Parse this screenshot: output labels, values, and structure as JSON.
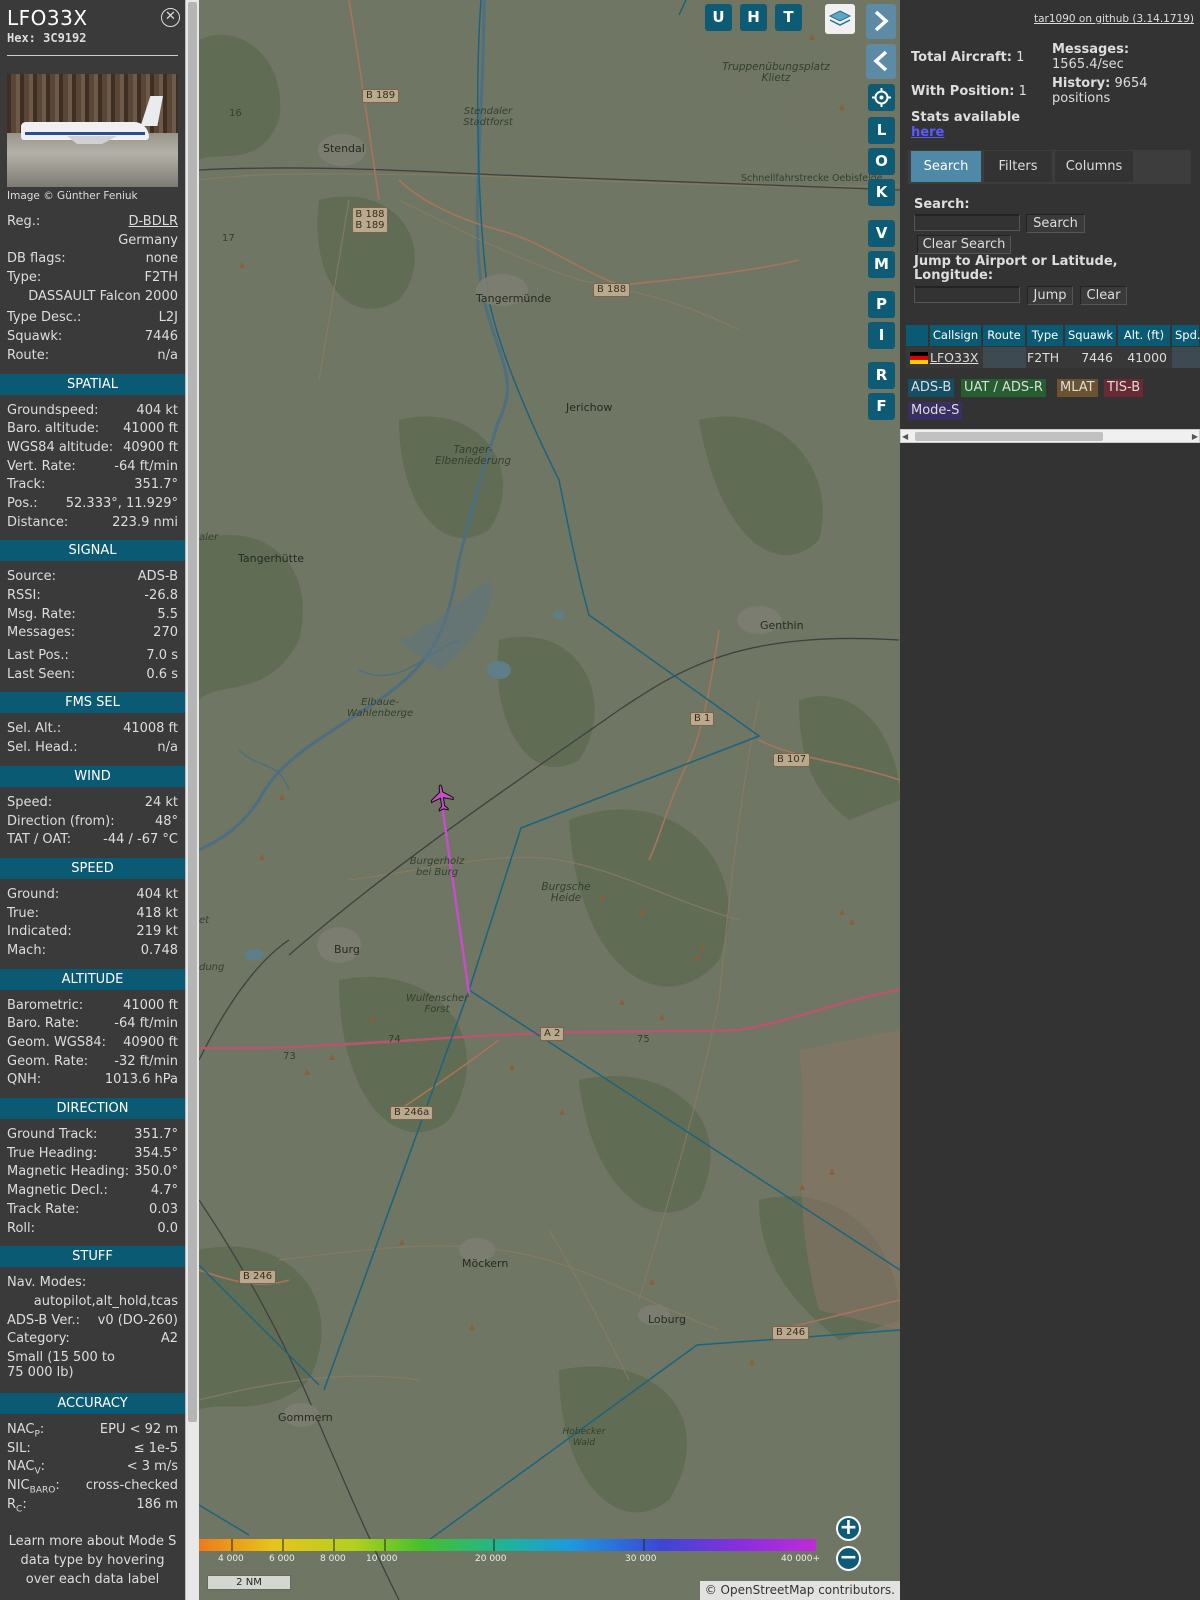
{
  "aircraft": {
    "callsign": "LFO33X",
    "hex": "Hex: 3C9192",
    "image_credit": "Image © Günther Feniuk",
    "reg_label": "Reg.:",
    "reg": "D-BDLR",
    "country": "Germany",
    "dbflags_label": "DB flags:",
    "dbflags": "none",
    "type_label": "Type:",
    "type": "F2TH",
    "type_full": "DASSAULT Falcon 2000",
    "typedesc_label": "Type Desc.:",
    "typedesc": "L2J",
    "squawk_label": "Squawk:",
    "squawk": "7446",
    "route_label": "Route:",
    "route": "n/a"
  },
  "sections": {
    "spatial": "SPATIAL",
    "signal": "SIGNAL",
    "fms": "FMS SEL",
    "wind": "WIND",
    "speed": "SPEED",
    "altitude": "ALTITUDE",
    "direction": "DIRECTION",
    "stuff": "STUFF",
    "accuracy": "ACCURACY"
  },
  "spatial": [
    {
      "k": "Groundspeed:",
      "v": "404 kt"
    },
    {
      "k": "Baro. altitude:",
      "v": "41000 ft"
    },
    {
      "k": "WGS84 altitude:",
      "v": "40900 ft"
    },
    {
      "k": "Vert. Rate:",
      "v": "-64 ft/min"
    },
    {
      "k": "Track:",
      "v": "351.7°"
    },
    {
      "k": "Pos.:",
      "v": "52.333°, 11.929°"
    },
    {
      "k": "Distance:",
      "v": "223.9 nmi"
    }
  ],
  "signal": [
    {
      "k": "Source:",
      "v": "ADS-B"
    },
    {
      "k": "RSSI:",
      "v": "-26.8"
    },
    {
      "k": "Msg. Rate:",
      "v": "5.5"
    },
    {
      "k": "Messages:",
      "v": "270"
    },
    {
      "k": "Last Pos.:",
      "v": "7.0 s"
    },
    {
      "k": "Last Seen:",
      "v": "0.6 s"
    }
  ],
  "fms": [
    {
      "k": "Sel. Alt.:",
      "v": "41008 ft"
    },
    {
      "k": "Sel. Head.:",
      "v": "n/a"
    }
  ],
  "wind": [
    {
      "k": "Speed:",
      "v": "24 kt"
    },
    {
      "k": "Direction (from):",
      "v": "48°"
    },
    {
      "k": "TAT / OAT:",
      "v": "-44 / -67 °C"
    }
  ],
  "speed": [
    {
      "k": "Ground:",
      "v": "404 kt"
    },
    {
      "k": "True:",
      "v": "418 kt"
    },
    {
      "k": "Indicated:",
      "v": "219 kt"
    },
    {
      "k": "Mach:",
      "v": "0.748"
    }
  ],
  "altitude": [
    {
      "k": "Barometric:",
      "v": "41000 ft"
    },
    {
      "k": "Baro. Rate:",
      "v": "-64 ft/min"
    },
    {
      "k": "Geom. WGS84:",
      "v": "40900 ft"
    },
    {
      "k": "Geom. Rate:",
      "v": "-32 ft/min"
    },
    {
      "k": "QNH:",
      "v": "1013.6 hPa"
    }
  ],
  "direction": [
    {
      "k": "Ground Track:",
      "v": "351.7°"
    },
    {
      "k": "True Heading:",
      "v": "354.5°"
    },
    {
      "k": "Magnetic Heading:",
      "v": "350.0°"
    },
    {
      "k": "Magnetic Decl.:",
      "v": "4.7°"
    },
    {
      "k": "Track Rate:",
      "v": "0.03"
    },
    {
      "k": "Roll:",
      "v": "0.0"
    }
  ],
  "stuff": {
    "navmodes_label": "Nav. Modes:",
    "navmodes": "autopilot,alt_hold,tcas",
    "adsb_label": "ADS-B Ver.:",
    "adsb": "v0 (DO-260)",
    "cat_label": "Category:",
    "cat": "A2",
    "cat_desc": "Small (15 500 to 75 000 lb)"
  },
  "accuracy": [
    {
      "k": "NACP:",
      "v": "EPU < 92 m"
    },
    {
      "k": "SIL:",
      "v": "≤ 1e-5"
    },
    {
      "k": "NACV:",
      "v": "< 3 m/s"
    },
    {
      "k": "NICBARO:",
      "v": "cross-checked"
    },
    {
      "k": "RC:",
      "v": "186 m"
    }
  ],
  "learn_more": "Learn more about Mode S data type by hovering over each data label",
  "map": {
    "places": [
      "Stendal",
      "Tangermünde",
      "Jerichow",
      "Tangerhütte",
      "Genthin",
      "Burg",
      "Möckern",
      "Loburg",
      "Gommern"
    ],
    "areas": [
      "Truppenübungsplatz Klietz",
      "Stendaler Stadtforst",
      "Tanger-Elbeniederung",
      "Elbaue-Wahlenberge",
      "Burgerholz bei Burg",
      "Burgsche Heide",
      "Wulfenscher Forst",
      "Hobecker Wald",
      "Schnellfahrstrecke Oebisfelde"
    ],
    "roads": [
      "B 189",
      "B 188 B 189",
      "B 188",
      "B 1",
      "B 107",
      "A 2",
      "B 246a",
      "B 246",
      "B 246"
    ],
    "km_marks": [
      "16",
      "17",
      "73",
      "74",
      "75"
    ],
    "edge_left": [
      "aler",
      "dung",
      "et"
    ],
    "scale_ticks": [
      "4 000",
      "6 000",
      "8 000",
      "10 000",
      "20 000",
      "30 000",
      "40 000+"
    ],
    "scale_bar": "2 NM",
    "attribution": "© OpenStreetMap contributors.",
    "letter_buttons": [
      "U",
      "H",
      "T"
    ],
    "side_buttons": [
      "L",
      "O",
      "K",
      "V",
      "M",
      "P",
      "I",
      "R",
      "F"
    ],
    "zoom_in": "+",
    "zoom_out": "−"
  },
  "right": {
    "github": "tar1090 on github (3.14.1719)",
    "total_label": "Total Aircraft:",
    "total": "1",
    "withpos_label": "With Position:",
    "withpos": "1",
    "messages_label": "Messages:",
    "messages": "1565.4/sec",
    "history_label": "History:",
    "history": "9654",
    "history_unit": "positions",
    "stats_label": "Stats available",
    "stats_link": "here",
    "tabs": [
      "Search",
      "Filters",
      "Columns"
    ],
    "search_label": "Search:",
    "search_btn": "Search",
    "clear_search": "Clear Search",
    "jump_label": "Jump to Airport or Latitude, Longitude:",
    "jump_btn": "Jump",
    "clear_btn": "Clear",
    "columns": [
      "Callsign",
      "Route",
      "Type",
      "Squawk",
      "Alt. (ft)",
      "Spd."
    ],
    "row": {
      "callsign": "LFO33X",
      "route": "",
      "type": "F2TH",
      "squawk": "7446",
      "alt": "41000"
    },
    "legend": [
      "ADS-B",
      "UAT / ADS-R",
      "MLAT",
      "TIS-B",
      "Mode-S"
    ]
  },
  "colors": {
    "accent": "#0b5a74",
    "track": "#c64ec9",
    "adsb": "#164e64",
    "uat": "#265e32",
    "mlat": "#6b5230",
    "tisb": "#6a2a34",
    "modes": "#3a2f62"
  }
}
